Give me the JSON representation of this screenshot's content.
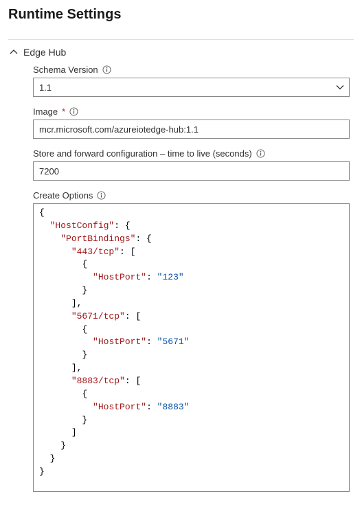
{
  "page": {
    "title": "Runtime Settings"
  },
  "section": {
    "title": "Edge Hub",
    "expanded": true
  },
  "fields": {
    "schema": {
      "label": "Schema Version",
      "value": "1.1"
    },
    "image": {
      "label": "Image",
      "required": "*",
      "value": "mcr.microsoft.com/azureiotedge-hub:1.1"
    },
    "ttl": {
      "label": "Store and forward configuration – time to live (seconds)",
      "value": "7200"
    },
    "createOptions": {
      "label": "Create Options"
    }
  },
  "createOptionsJson": {
    "HostConfig": {
      "PortBindings": {
        "443/tcp": [
          {
            "HostPort": "123"
          }
        ],
        "5671/tcp": [
          {
            "HostPort": "5671"
          }
        ],
        "8883/tcp": [
          {
            "HostPort": "8883"
          }
        ]
      }
    }
  },
  "chart_data": null
}
